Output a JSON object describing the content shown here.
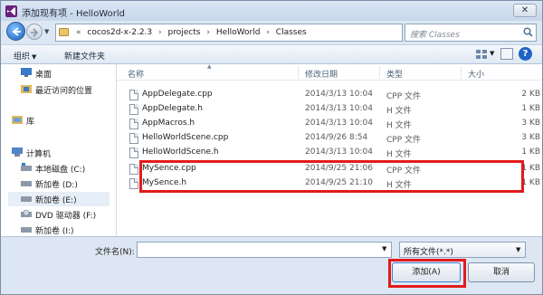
{
  "window": {
    "title": "添加现有项 - HelloWorld",
    "close_glyph": "✕"
  },
  "address_bar": {
    "overflow_glyph": "«",
    "breadcrumbs": [
      "cocos2d-x-2.2.3",
      "projects",
      "HelloWorld",
      "Classes"
    ],
    "separator": "›",
    "refresh_glyph": "↻"
  },
  "search": {
    "placeholder": "搜索 Classes"
  },
  "toolbar": {
    "organize_label": "组织",
    "new_folder_label": "新建文件夹",
    "help_glyph": "?"
  },
  "nav_pane": {
    "items": [
      {
        "label": "桌面",
        "icon": "desktop-icon"
      },
      {
        "label": "最近访问的位置",
        "icon": "recent-places-icon"
      },
      {
        "label": "库",
        "icon": "library-icon"
      },
      {
        "label": "计算机",
        "icon": "computer-icon"
      },
      {
        "label": "本地磁盘 (C:)",
        "icon": "hard-drive-icon"
      },
      {
        "label": "新加卷 (D:)",
        "icon": "drive-icon"
      },
      {
        "label": "新加卷 (E:)",
        "icon": "drive-icon"
      },
      {
        "label": "DVD 驱动器 (F:)",
        "icon": "dvd-drive-icon"
      },
      {
        "label": "新加卷 (I:)",
        "icon": "drive-icon"
      }
    ]
  },
  "file_list": {
    "columns": {
      "name": "名称",
      "date": "修改日期",
      "type": "类型",
      "size": "大小"
    },
    "rows": [
      {
        "name": "AppDelegate.cpp",
        "date": "2014/3/13 10:04",
        "type": "CPP 文件",
        "size": "2 KB"
      },
      {
        "name": "AppDelegate.h",
        "date": "2014/3/13 10:04",
        "type": "H 文件",
        "size": "1 KB"
      },
      {
        "name": "AppMacros.h",
        "date": "2014/3/13 10:04",
        "type": "H 文件",
        "size": "3 KB"
      },
      {
        "name": "HelloWorldScene.cpp",
        "date": "2014/9/26 8:54",
        "type": "CPP 文件",
        "size": "3 KB"
      },
      {
        "name": "HelloWorldScene.h",
        "date": "2014/3/13 10:04",
        "type": "H 文件",
        "size": "1 KB"
      },
      {
        "name": "MySence.cpp",
        "date": "2014/9/25 21:06",
        "type": "CPP 文件",
        "size": "1 KB"
      },
      {
        "name": "MySence.h",
        "date": "2014/9/25 21:10",
        "type": "H 文件",
        "size": "1 KB"
      }
    ]
  },
  "bottom": {
    "filename_label": "文件名(N):",
    "filename_value": "",
    "filter_value": "所有文件(*.*)",
    "add_button": "添加(A)",
    "cancel_button": "取消"
  },
  "colors": {
    "highlight_border": "#e21b1b",
    "window_bg": "#dde7f3",
    "accent_blue": "#1f63c4"
  }
}
